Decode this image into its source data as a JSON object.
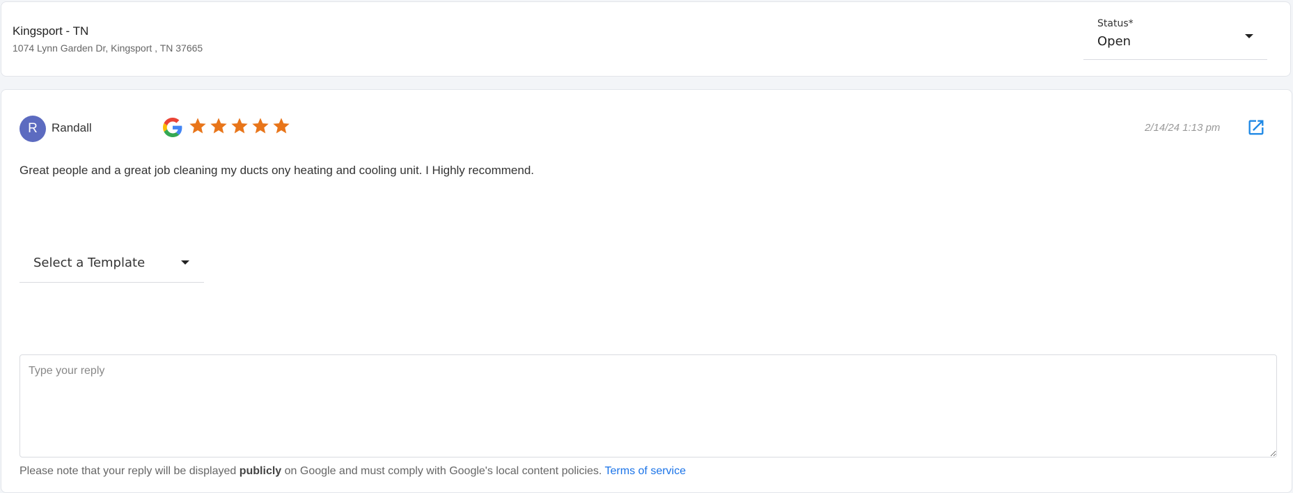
{
  "location": {
    "name": "Kingsport - TN",
    "address": "1074 Lynn Garden Dr, Kingsport , TN 37665"
  },
  "status": {
    "label": "Status*",
    "value": "Open"
  },
  "review": {
    "avatar_initial": "R",
    "reviewer": "Randall",
    "source_icon": "google-icon",
    "rating": 5,
    "rating_max": 5,
    "star_color": "#e8751a",
    "date": "2/14/24 1:13 pm",
    "text": "Great people and a great job cleaning my ducts ony heating and cooling unit. I Highly recommend."
  },
  "reply": {
    "template_label": "Select a Template",
    "placeholder": "Type your reply",
    "disclaimer_pre": "Please note that your reply will be displayed ",
    "disclaimer_bold": "publicly",
    "disclaimer_post": " on Google and must comply with Google's local content policies. ",
    "terms_link": "Terms of service"
  },
  "colors": {
    "avatar": "#5c6bc0",
    "link": "#1a73e8",
    "external_icon": "#1e88e5"
  }
}
